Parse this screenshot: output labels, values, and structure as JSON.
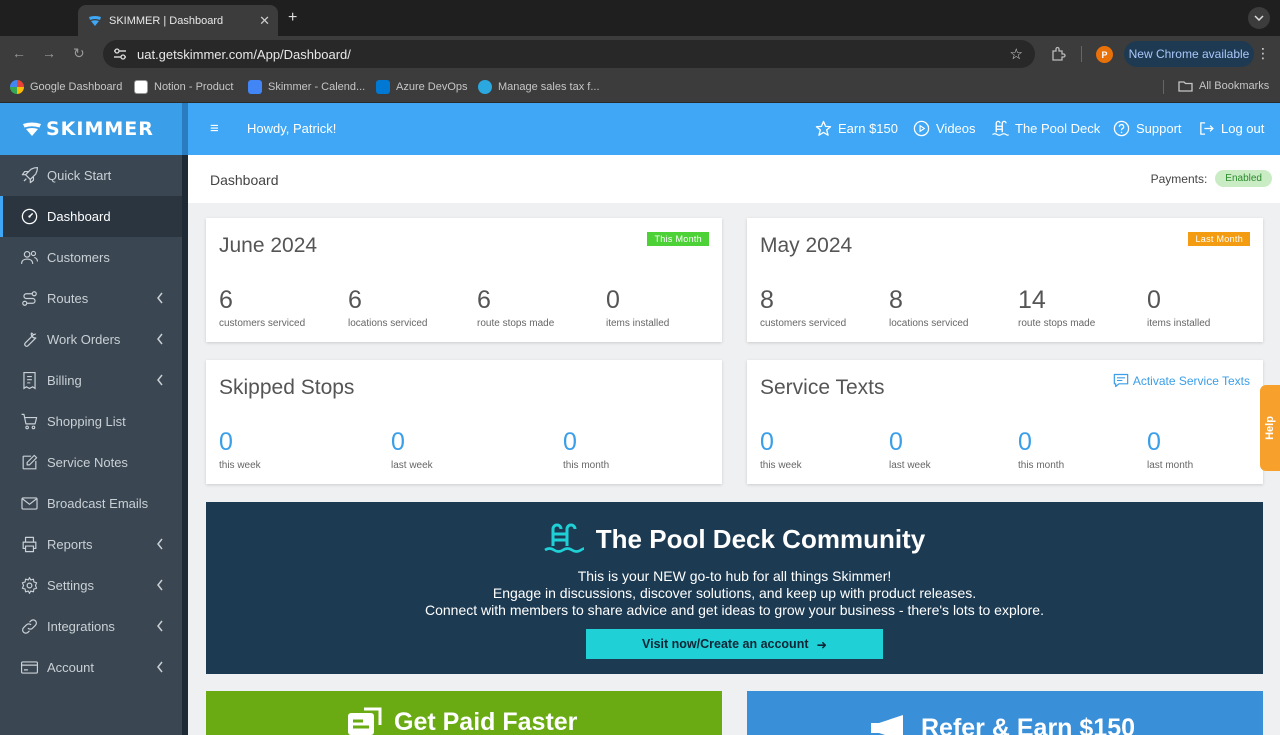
{
  "browser": {
    "tab_title": "SKIMMER | Dashboard",
    "url": "uat.getskimmer.com/App/Dashboard/",
    "profile_initial": "P",
    "new_chrome": "New Chrome available",
    "bookmarks": [
      {
        "label": "Google Dashboard",
        "color": "#ea4335"
      },
      {
        "label": "Notion - Product",
        "color": "#ffffff"
      },
      {
        "label": "Skimmer - Calend...",
        "color": "#4285f4"
      },
      {
        "label": "Azure DevOps",
        "color": "#0078d4"
      },
      {
        "label": "Manage sales tax f...",
        "color": "#2ca8e0"
      }
    ],
    "all_bookmarks": "All Bookmarks"
  },
  "header": {
    "logo": "SKIMMER",
    "greeting": "Howdy, Patrick!",
    "links": {
      "earn": "Earn $150",
      "videos": "Videos",
      "pool_deck": "The Pool Deck",
      "support": "Support",
      "logout": "Log out"
    }
  },
  "sidebar": {
    "items": [
      {
        "label": "Quick Start",
        "icon": "rocket-icon",
        "chevron": false
      },
      {
        "label": "Dashboard",
        "icon": "speedometer-icon",
        "chevron": false,
        "active": true
      },
      {
        "label": "Customers",
        "icon": "users-icon",
        "chevron": false
      },
      {
        "label": "Routes",
        "icon": "routes-icon",
        "chevron": true
      },
      {
        "label": "Work Orders",
        "icon": "wrench-icon",
        "chevron": true
      },
      {
        "label": "Billing",
        "icon": "invoice-icon",
        "chevron": true
      },
      {
        "label": "Shopping List",
        "icon": "cart-icon",
        "chevron": false
      },
      {
        "label": "Service Notes",
        "icon": "notes-icon",
        "chevron": false
      },
      {
        "label": "Broadcast Emails",
        "icon": "mail-icon",
        "chevron": false
      },
      {
        "label": "Reports",
        "icon": "printer-icon",
        "chevron": true
      },
      {
        "label": "Settings",
        "icon": "gear-icon",
        "chevron": true
      },
      {
        "label": "Integrations",
        "icon": "link-icon",
        "chevron": true
      },
      {
        "label": "Account",
        "icon": "card-icon",
        "chevron": true
      }
    ]
  },
  "page": {
    "title": "Dashboard",
    "payments_label": "Payments:",
    "payments_status": "Enabled"
  },
  "cards": {
    "this_month": {
      "title": "June 2024",
      "tag": "This Month",
      "tag_color": "#4cd137",
      "stats": [
        {
          "value": "6",
          "label": "customers serviced"
        },
        {
          "value": "6",
          "label": "locations serviced"
        },
        {
          "value": "6",
          "label": "route stops made"
        },
        {
          "value": "0",
          "label": "items installed"
        }
      ]
    },
    "last_month": {
      "title": "May 2024",
      "tag": "Last Month",
      "tag_color": "#f39c12",
      "stats": [
        {
          "value": "8",
          "label": "customers serviced"
        },
        {
          "value": "8",
          "label": "locations serviced"
        },
        {
          "value": "14",
          "label": "route stops made"
        },
        {
          "value": "0",
          "label": "items installed"
        }
      ]
    },
    "skipped": {
      "title": "Skipped Stops",
      "stats": [
        {
          "value": "0",
          "label": "this week"
        },
        {
          "value": "0",
          "label": "last week"
        },
        {
          "value": "0",
          "label": "this month"
        }
      ]
    },
    "service_texts": {
      "title": "Service Texts",
      "action": "Activate Service Texts",
      "stats": [
        {
          "value": "0",
          "label": "this week"
        },
        {
          "value": "0",
          "label": "last week"
        },
        {
          "value": "0",
          "label": "this month"
        },
        {
          "value": "0",
          "label": "last month"
        }
      ]
    }
  },
  "banner": {
    "title": "The Pool Deck Community",
    "lines": [
      "This is your NEW go-to hub for all things Skimmer!",
      "Engage in discussions, discover solutions, and keep up with product releases.",
      "Connect with members to share advice and get ideas to grow your business - there's lots to explore."
    ],
    "cta": "Visit now/Create an account",
    "cta_arrow": "➜"
  },
  "promos": {
    "paid": {
      "title": "Get Paid Faster",
      "color": "#6aaa12"
    },
    "refer": {
      "title": "Refer & Earn $150",
      "color": "#3a8fd9"
    }
  },
  "help": "Help"
}
